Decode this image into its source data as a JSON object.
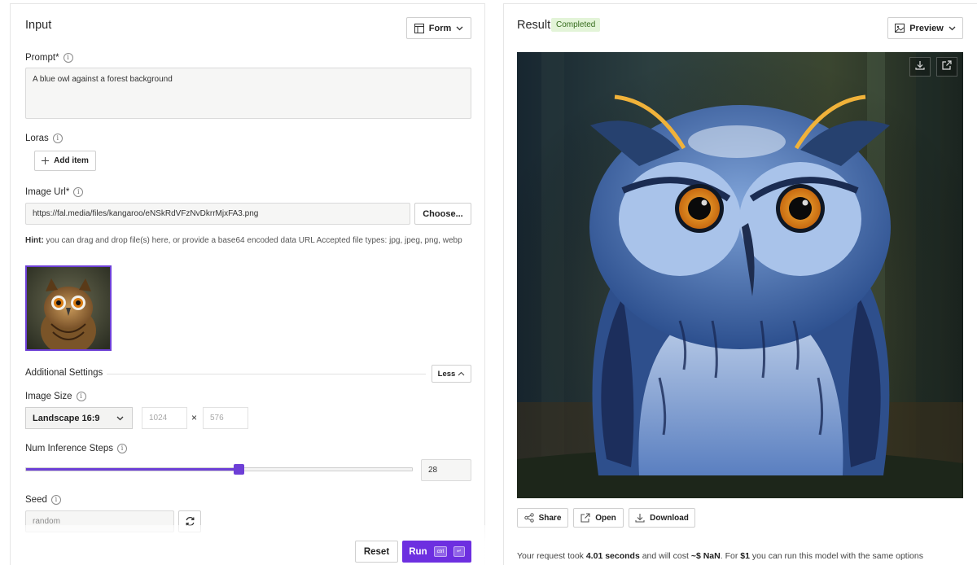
{
  "input_panel": {
    "title": "Input",
    "mode_button": "Form",
    "prompt": {
      "label": "Prompt*",
      "value": "A blue owl against a forest background"
    },
    "loras": {
      "label": "Loras",
      "add_button": "Add item"
    },
    "image_url": {
      "label": "Image Url*",
      "value": "https://fal.media/files/kangaroo/eNSkRdVFzNvDkrrMjxFA3.png",
      "choose_button": "Choose...",
      "hint_bold": "Hint:",
      "hint_text": " you can drag and drop file(s) here, or provide a base64 encoded data URL Accepted file types: jpg, jpeg, png, webp"
    },
    "additional_settings": {
      "label": "Additional Settings",
      "toggle_button": "Less"
    },
    "image_size": {
      "label": "Image Size",
      "selected": "Landscape 16:9",
      "width": "1024",
      "height": "576",
      "times": "×"
    },
    "inference_steps": {
      "label": "Num Inference Steps",
      "value": "28",
      "fraction": 0.55
    },
    "seed": {
      "label": "Seed",
      "placeholder": "random"
    },
    "reset_button": "Reset",
    "run_button": "Run",
    "run_shortcut": "ctrl",
    "run_shortcut_key": "↵"
  },
  "result_panel": {
    "title": "Result",
    "status": "Completed",
    "preview_button": "Preview",
    "share_button": "Share",
    "open_button": "Open",
    "download_button": "Download",
    "summary_prefix": "Your request took ",
    "summary_time": "4.01 seconds",
    "summary_mid": " and will cost ",
    "summary_cost": "~$ NaN",
    "summary_mid2": ". For ",
    "summary_budget": "$1",
    "summary_suffix": " you can run this model with the same options"
  },
  "colors": {
    "accent": "#6d3fd6",
    "status_bg": "#e3f4d8",
    "status_text": "#356b1c"
  }
}
